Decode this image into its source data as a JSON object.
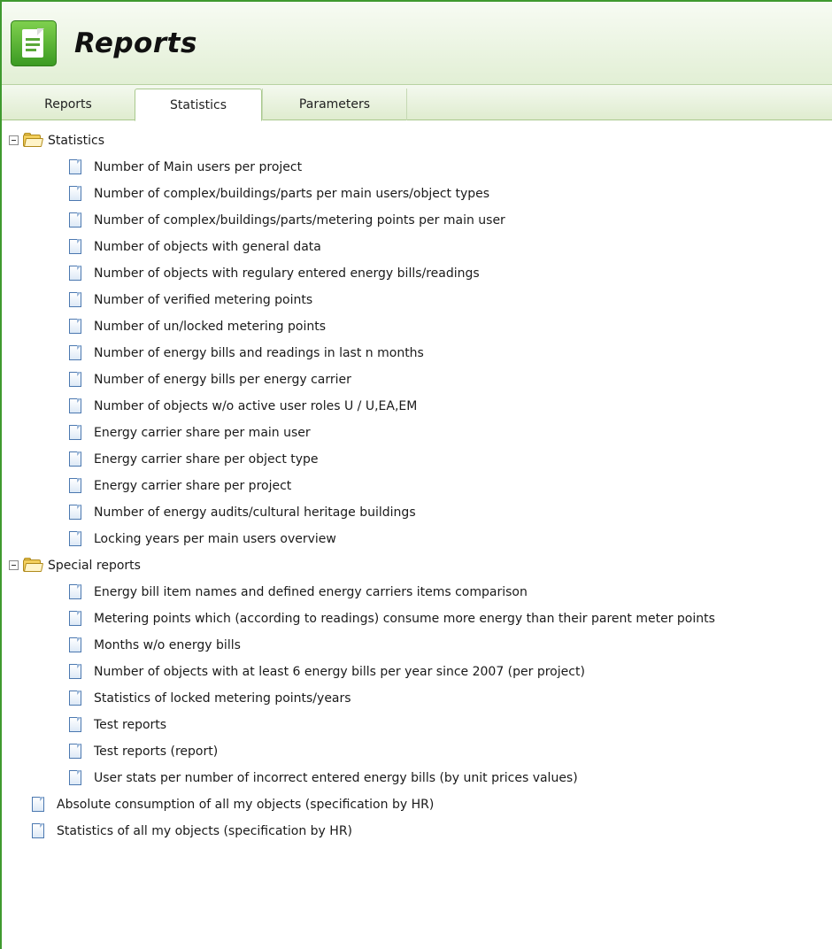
{
  "header": {
    "title": "Reports"
  },
  "tabs": [
    {
      "label": "Reports"
    },
    {
      "label": "Statistics"
    },
    {
      "label": "Parameters"
    }
  ],
  "tree": {
    "statistics_folder": {
      "label": "Statistics",
      "items": [
        {
          "label": "Number of Main users per project"
        },
        {
          "label": "Number of complex/buildings/parts per main users/object types"
        },
        {
          "label": "Number of complex/buildings/parts/metering points per main user"
        },
        {
          "label": "Number of objects with general data"
        },
        {
          "label": "Number of objects with regulary entered energy bills/readings"
        },
        {
          "label": "Number of verified metering points"
        },
        {
          "label": "Number of un/locked metering points"
        },
        {
          "label": "Number of energy bills and readings in last n months"
        },
        {
          "label": "Number of energy bills per energy carrier"
        },
        {
          "label": "Number of objects w/o active user roles U / U,EA,EM"
        },
        {
          "label": "Energy carrier share per main user"
        },
        {
          "label": "Energy carrier share per object type"
        },
        {
          "label": "Energy carrier share per project"
        },
        {
          "label": "Number of energy audits/cultural heritage buildings"
        },
        {
          "label": "Locking years per main users overview"
        }
      ]
    },
    "special_folder": {
      "label": "Special reports",
      "items": [
        {
          "label": "Energy bill item names and defined energy carriers items comparison"
        },
        {
          "label": "Metering points which (according to readings) consume more energy than their parent meter points"
        },
        {
          "label": "Months w/o energy bills"
        },
        {
          "label": "Number of objects with at least 6 energy bills per year since 2007 (per project)"
        },
        {
          "label": "Statistics of locked metering points/years"
        },
        {
          "label": "Test reports"
        },
        {
          "label": "Test reports (report)"
        },
        {
          "label": "User stats per number of incorrect entered energy bills (by unit prices values)"
        }
      ]
    },
    "top_items": [
      {
        "label": "Absolute consumption of all my objects (specification by HR)"
      },
      {
        "label": "Statistics of all my objects (specification by HR)"
      }
    ]
  }
}
